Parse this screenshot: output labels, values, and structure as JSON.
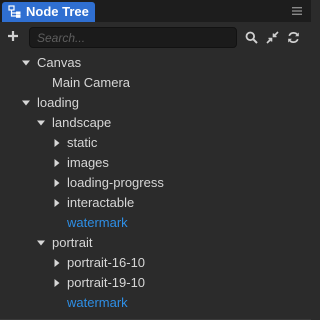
{
  "tab": {
    "title": "Node Tree",
    "icon": "node-tree-icon"
  },
  "menu": {
    "icon": "hamburger-menu-icon"
  },
  "toolbar": {
    "add_icon": "plus-icon",
    "search_placeholder": "Search...",
    "search_value": "",
    "search_icon": "magnifier-icon",
    "collapse_icon": "collapse-arrows-icon",
    "refresh_icon": "refresh-icon"
  },
  "colors": {
    "accent": "#2f6fd1",
    "background": "#2b2b2b",
    "text": "#d6d6d6",
    "prefab_text": "#2e8fe6"
  },
  "tree": {
    "canvas": "Canvas",
    "main_camera": "Main Camera",
    "loading": "loading",
    "landscape": "landscape",
    "static": "static",
    "images": "images",
    "loading_progress": "loading-progress",
    "interactable": "interactable",
    "watermark_landscape": "watermark",
    "portrait": "portrait",
    "portrait_16_10": "portrait-16-10",
    "portrait_19_10": "portrait-19-10",
    "watermark_portrait": "watermark"
  }
}
